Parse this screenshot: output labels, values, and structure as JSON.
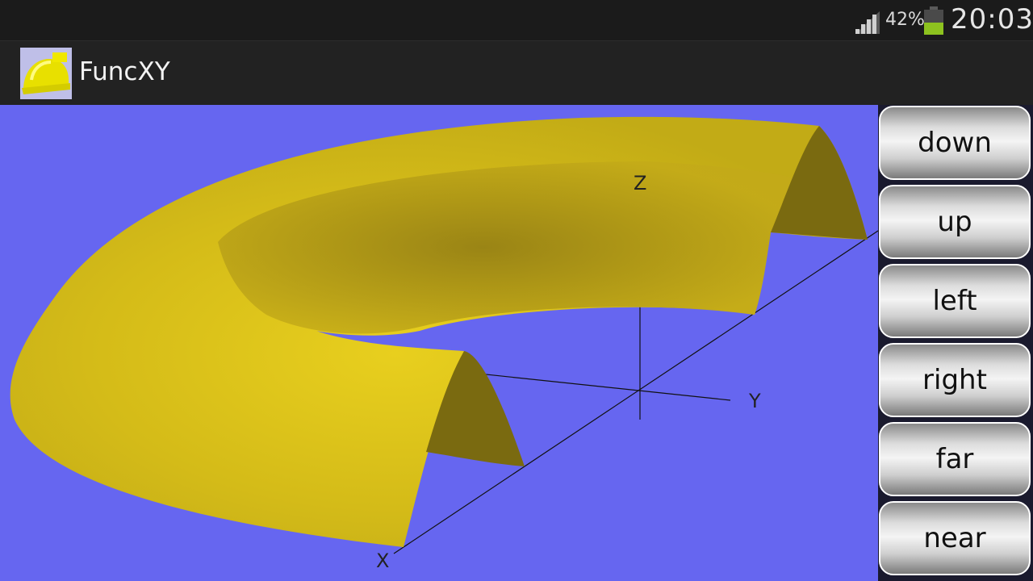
{
  "status_bar": {
    "battery_percent": "42%",
    "time": "20:03",
    "icons": [
      "signal-icon",
      "battery-icon"
    ],
    "battery_level": 0.42,
    "battery_color": "#8dc21f"
  },
  "app": {
    "title": "FuncXY",
    "logo_icon": "hard-hat-icon"
  },
  "viewport": {
    "background_color": "#6666f0",
    "surface_color": "#d9c21a",
    "axes": {
      "x": "X",
      "y": "Y",
      "z": "Z"
    }
  },
  "controls": [
    {
      "label": "down"
    },
    {
      "label": "up"
    },
    {
      "label": "left"
    },
    {
      "label": "right"
    },
    {
      "label": "far"
    },
    {
      "label": "near"
    }
  ]
}
